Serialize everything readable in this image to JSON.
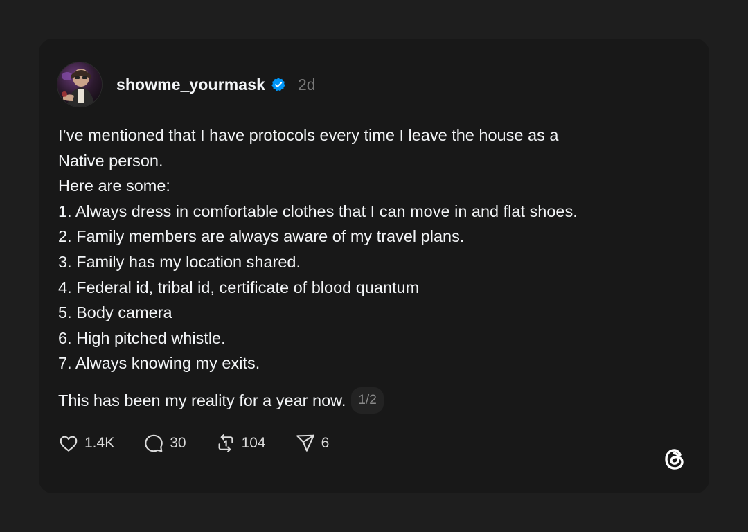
{
  "post": {
    "username": "showme_yourmask",
    "verified": true,
    "time": "2d",
    "body_lines": [
      "I’ve mentioned that I have protocols every time I leave the house as a",
      "Native person.",
      "Here are some:",
      "1. Always dress in comfortable clothes that I can move in and flat shoes.",
      "2. Family members are always aware of my travel plans.",
      "3. Family has my location shared.",
      "4. Federal id, tribal id, certificate of blood quantum",
      "5. Body camera",
      "6. High pitched whistle.",
      "7. Always knowing my exits."
    ],
    "closing": "This has been my reality for a year now.",
    "pager": "1/2"
  },
  "actions": {
    "likes": "1.4K",
    "replies": "30",
    "reposts": "104",
    "shares": "6"
  },
  "icons": {
    "verified": "verified-badge-icon",
    "like": "heart-icon",
    "reply": "comment-icon",
    "repost": "repost-icon",
    "share": "send-icon",
    "logo": "threads-logo-icon"
  },
  "colors": {
    "page_bg": "#1e1e1e",
    "card_bg": "#181818",
    "text": "#f3f5f7",
    "muted": "#777777",
    "verified_blue": "#0095f6"
  }
}
